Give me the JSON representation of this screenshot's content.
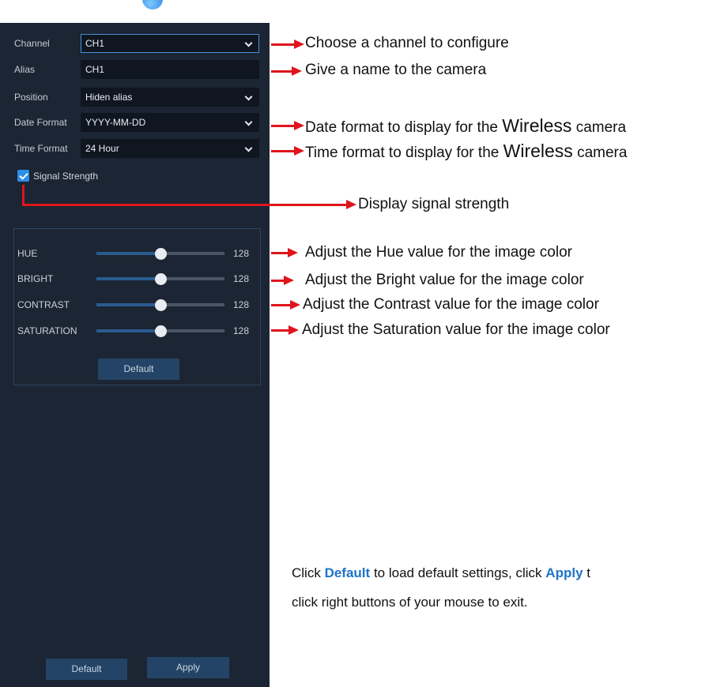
{
  "panel": {
    "channel": {
      "label": "Channel",
      "value": "CH1"
    },
    "alias": {
      "label": "Alias",
      "value": "CH1"
    },
    "position": {
      "label": "Position",
      "value": "Hiden alias"
    },
    "date_format": {
      "label": "Date Format",
      "value": "YYYY-MM-DD"
    },
    "time_format": {
      "label": "Time Format",
      "value": "24 Hour"
    },
    "signal_strength": {
      "label": "Signal Strength",
      "checked": true
    },
    "image": {
      "sliders": [
        {
          "label": "HUE",
          "value": "128",
          "level": 0.5
        },
        {
          "label": "BRIGHT",
          "value": "128",
          "level": 0.5
        },
        {
          "label": "CONTRAST",
          "value": "128",
          "level": 0.5
        },
        {
          "label": "SATURATION",
          "value": "128",
          "level": 0.5
        }
      ],
      "default_label": "Default"
    },
    "footer": {
      "default_label": "Default",
      "apply_label": "Apply"
    }
  },
  "annotations": {
    "channel": "Choose a channel to configure",
    "alias": "Give a name to the camera",
    "date_prefix": "Date format to display for the",
    "date_word": "Wireless",
    "date_suffix": "camera",
    "time_prefix": "Time format to display for the",
    "time_word": "Wireless",
    "time_suffix": "camera",
    "signal": "Display signal strength",
    "hue": "Adjust the Hue value for the image color",
    "bright": "Adjust the Bright value for the image color",
    "contrast": "Adjust the Contrast value for the image color",
    "saturation": "Adjust the Saturation value for the image color"
  },
  "note": {
    "part1": "Click",
    "kw1": "Default",
    "part2": "to load default settings, click",
    "kw2": "Apply",
    "part3": "t",
    "line2": "click right buttons of your mouse to exit."
  },
  "colors": {
    "panel_bg": "#1c2533",
    "accent": "#2d8ee8",
    "button": "#234466",
    "arrow": "#e0141c",
    "keyword": "#1e73c8"
  }
}
